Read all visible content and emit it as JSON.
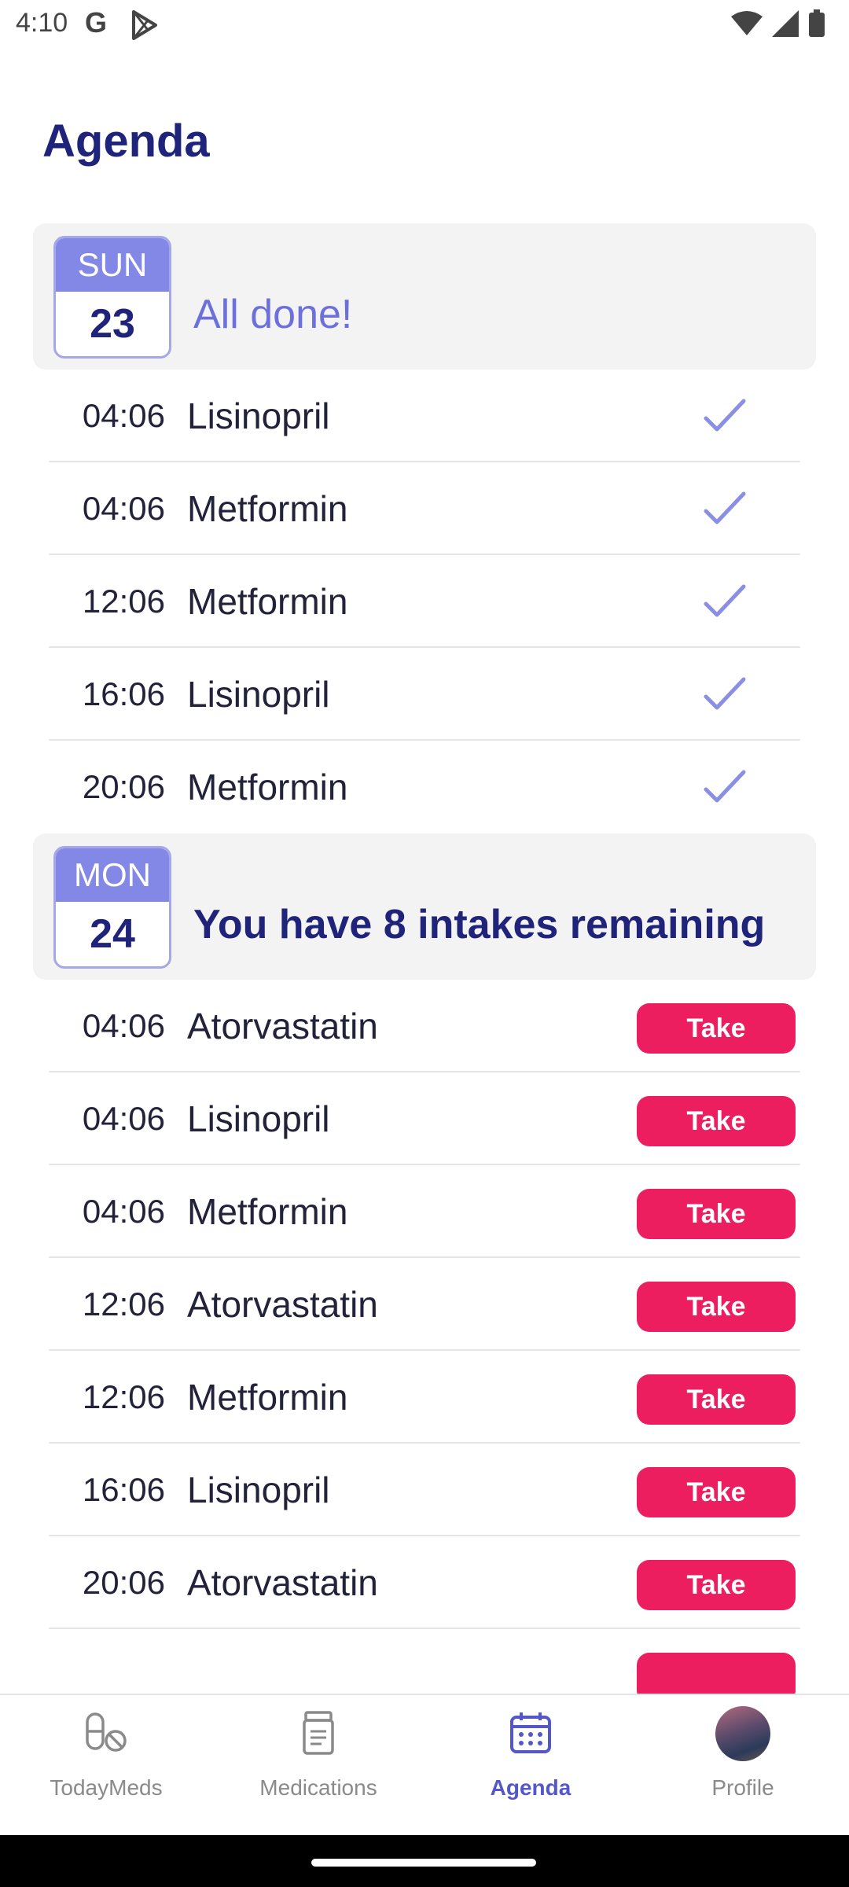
{
  "status_bar": {
    "time": "4:10",
    "google_glyph": "G"
  },
  "page": {
    "title": "Agenda"
  },
  "days": [
    {
      "weekday": "SUN",
      "day": "23",
      "message": "All done!",
      "items": [
        {
          "time": "04:06",
          "name": "Lisinopril",
          "done": true
        },
        {
          "time": "04:06",
          "name": "Metformin",
          "done": true
        },
        {
          "time": "12:06",
          "name": "Metformin",
          "done": true
        },
        {
          "time": "16:06",
          "name": "Lisinopril",
          "done": true
        },
        {
          "time": "20:06",
          "name": "Metformin",
          "done": true
        }
      ]
    },
    {
      "weekday": "MON",
      "day": "24",
      "message": "You have 8 intakes remaining",
      "items": [
        {
          "time": "04:06",
          "name": "Atorvastatin",
          "action": "Take"
        },
        {
          "time": "04:06",
          "name": "Lisinopril",
          "action": "Take"
        },
        {
          "time": "04:06",
          "name": "Metformin",
          "action": "Take"
        },
        {
          "time": "12:06",
          "name": "Atorvastatin",
          "action": "Take"
        },
        {
          "time": "12:06",
          "name": "Metformin",
          "action": "Take"
        },
        {
          "time": "16:06",
          "name": "Lisinopril",
          "action": "Take"
        },
        {
          "time": "20:06",
          "name": "Atorvastatin",
          "action": "Take"
        },
        {
          "time": "",
          "name": "",
          "action": ""
        }
      ]
    }
  ],
  "nav": [
    {
      "label": "TodayMeds",
      "icon": "pill-icon"
    },
    {
      "label": "Medications",
      "icon": "prescription-bottle-icon"
    },
    {
      "label": "Agenda",
      "icon": "calendar-icon",
      "active": true
    },
    {
      "label": "Profile",
      "icon": "avatar"
    }
  ],
  "colors": {
    "accent": "#5357c9",
    "take": "#ec1e5f",
    "title": "#1f237a",
    "check": "#6c70db"
  }
}
